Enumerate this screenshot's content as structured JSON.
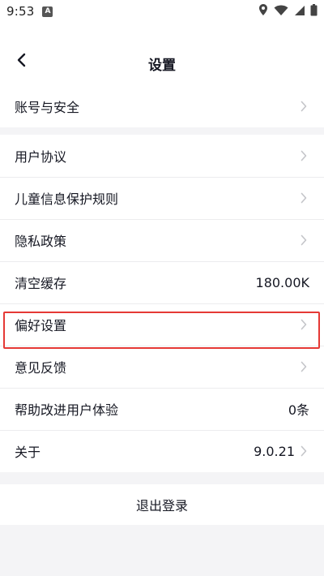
{
  "status_bar": {
    "time": "9:53",
    "notification_icon": "a-notification-icon",
    "icons": [
      "location-icon",
      "wifi-icon",
      "signal-icon",
      "battery-icon"
    ]
  },
  "header": {
    "title": "设置"
  },
  "groups": [
    {
      "items": [
        {
          "label": "账号与安全",
          "value": "",
          "chevron": true
        }
      ]
    },
    {
      "items": [
        {
          "label": "用户协议",
          "value": "",
          "chevron": true
        },
        {
          "label": "儿童信息保护规则",
          "value": "",
          "chevron": true
        },
        {
          "label": "隐私政策",
          "value": "",
          "chevron": true
        },
        {
          "label": "清空缓存",
          "value": "180.00K",
          "chevron": false
        },
        {
          "label": "偏好设置",
          "value": "",
          "chevron": true,
          "highlighted": true
        },
        {
          "label": "意见反馈",
          "value": "",
          "chevron": true
        },
        {
          "label": "帮助改进用户体验",
          "value": "0条",
          "chevron": false
        },
        {
          "label": "关于",
          "value": "9.0.21",
          "chevron": true
        }
      ]
    }
  ],
  "logout": {
    "label": "退出登录"
  },
  "colors": {
    "background": "#f4f4f6",
    "surface": "#ffffff",
    "text": "#161823",
    "chevron": "#c4c5c9",
    "highlight_border": "#e53935"
  }
}
